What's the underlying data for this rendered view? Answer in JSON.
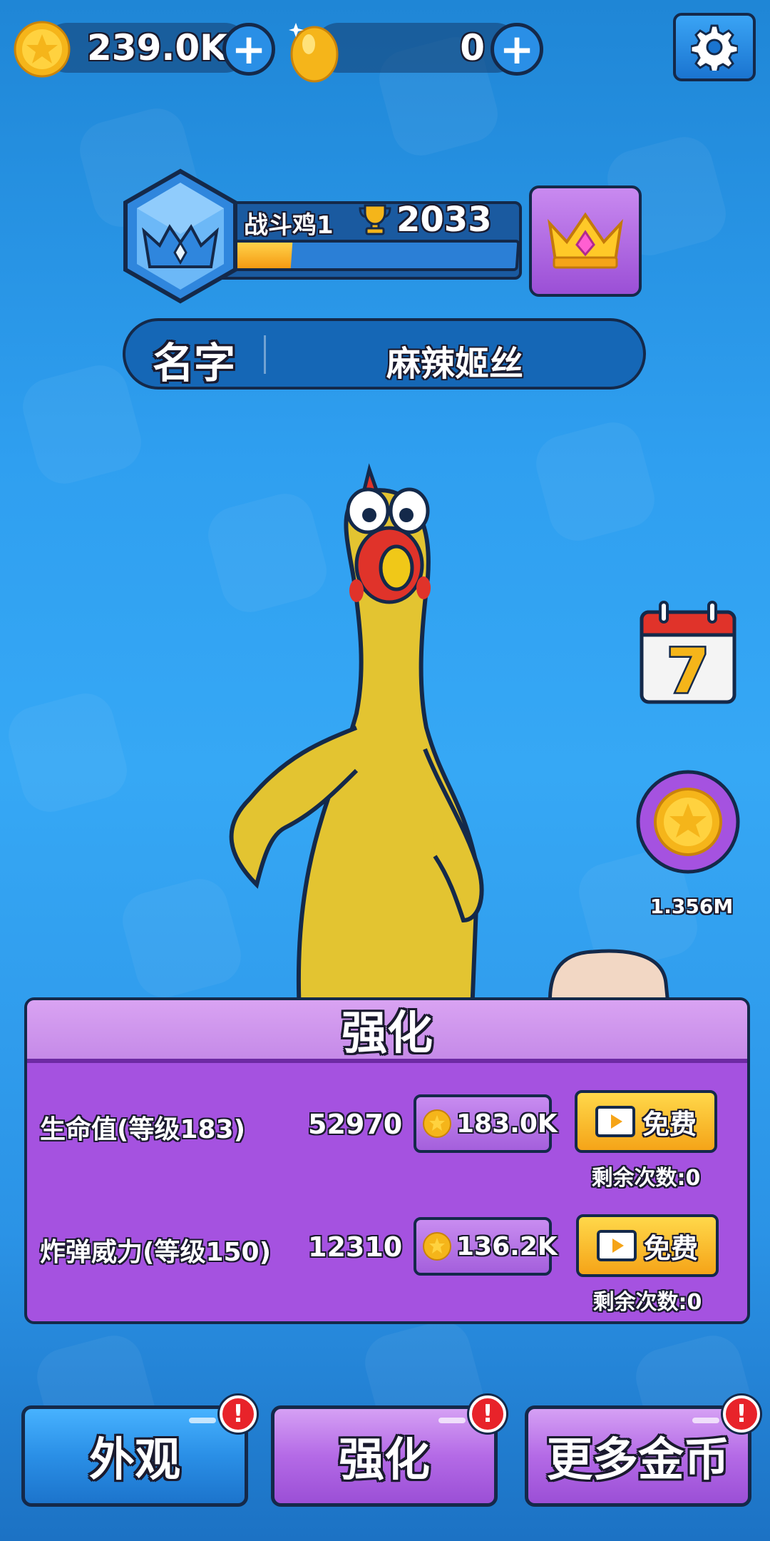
{
  "currency": {
    "coins": "239.0K",
    "eggs": "0",
    "plus_symbol": "+"
  },
  "profile": {
    "rank_name": "战斗鸡1",
    "trophies": "2033",
    "rank_progress": 0.22,
    "name_label": "名字",
    "name_value": "麻辣姬丝"
  },
  "side": {
    "calendar_day": "7",
    "coin_bonus_amount": "1.356M"
  },
  "upgrade_panel": {
    "title": "强化",
    "rows": [
      {
        "label": "生命值(等级183)",
        "value": "52970",
        "cost": "183.0K",
        "free_label": "免费",
        "remaining": "剩余次数:0"
      },
      {
        "label": "炸弹威力(等级150)",
        "value": "12310",
        "cost": "136.2K",
        "free_label": "免费",
        "remaining": "剩余次数:0"
      }
    ]
  },
  "nav": {
    "appearance": "外观",
    "upgrade": "强化",
    "more_coins": "更多金币",
    "alert_symbol": "!"
  },
  "colors": {
    "background": "#2f9ff0",
    "panel_purple": "#a552e0",
    "button_blue": "#2a8fe6",
    "button_yellow": "#f5a418",
    "alert_red": "#e8232a",
    "outline": "#14294a"
  },
  "icons": [
    "coin-icon",
    "egg-icon",
    "gear-icon",
    "trophy-icon",
    "rank-badge-icon",
    "crown-icon",
    "calendar-icon",
    "video-play-icon"
  ]
}
